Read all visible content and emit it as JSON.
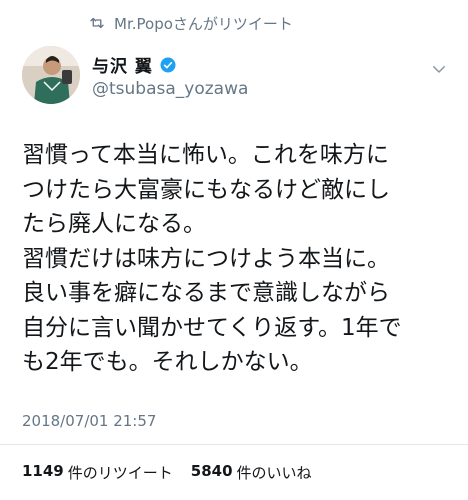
{
  "retweet": {
    "label": "Mr.Popoさんがリツイート"
  },
  "author": {
    "name": "与沢 翼",
    "handle": "@tsubasa_yozawa"
  },
  "tweet": {
    "text": "習慣って本当に怖い。これを味方に\nつけたら大富豪にもなるけど敵にし\nたら廃人になる。\n習慣だけは味方につけよう本当に。\n良い事を癖になるまで意識しながら\n自分に言い聞かせてくり返す。1年で\nも2年でも。それしかない。",
    "timestamp": "2018/07/01 21:57"
  },
  "stats": {
    "retweets_count": "1149",
    "retweets_label": "件のリツイート",
    "likes_count": "5840",
    "likes_label": "件のいいね"
  },
  "colors": {
    "verified": "#1da1f2",
    "secondary_text": "#657786",
    "divider": "#e1e8ed"
  }
}
